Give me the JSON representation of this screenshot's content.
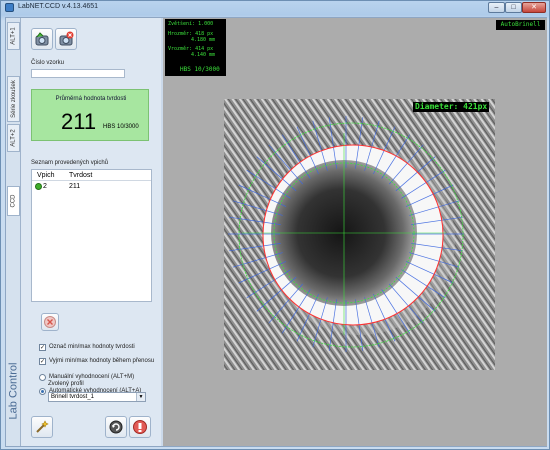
{
  "window": {
    "title": "LabNET.CCD v.4.13.4651",
    "controls": {
      "minimize": "–",
      "maximize": "□",
      "close": "✕"
    }
  },
  "tabs": {
    "top_tab": "ALT+1",
    "series_tab": "Série zkoušek",
    "alt2_tab": "ALT+2",
    "ccd_tab": "CCD",
    "brand": "Lab Control"
  },
  "panel": {
    "sample_label": "Číslo vzorku",
    "sample_value": "",
    "hardness": {
      "title": "Průměrná hodnota tvrdosti",
      "value": "211",
      "unit": "HBS 10/3000",
      "bg_color": "#a7e6a0"
    },
    "list": {
      "title": "Seznam provedených vpichů",
      "columns": [
        "Vpich",
        "Tvrdost"
      ],
      "rows": [
        {
          "status": "ok",
          "vpich": "2",
          "tvrdost": "211"
        }
      ]
    },
    "options": {
      "mark_minmax": "Označ min/max hodnoty tvrdosti",
      "exclude_minmax": "Vyjmi min/max hodnoty během přenosu",
      "manual": "Manuální vyhodnocení (ALT+M)",
      "automatic": "Automatické vyhodnocení (ALT+A)",
      "profile_label": "Zvolený profil",
      "profile_value": "Brinell tvrdost_1",
      "selected_mode": "automatic"
    },
    "icons": [
      "camera-icon",
      "camera-delete-icon",
      "delete-icon",
      "wand-icon",
      "refresh-icon",
      "stop-icon"
    ]
  },
  "viewer": {
    "readout": {
      "line1": "Zvětšení: 1.000",
      "line2a": "Hrozměr:  418 px",
      "line2b": "4.180 mm",
      "line3a": "Vrozměr:  414 px",
      "line3b": "4.140 mm",
      "line4": "HBS 10/3000"
    },
    "auto_label": "AutoBrinell",
    "diameter_label": "Diameter: 421px",
    "green_color": "#3be03b",
    "red_color": "#ff3030",
    "blue_color": "#3b66e0"
  }
}
